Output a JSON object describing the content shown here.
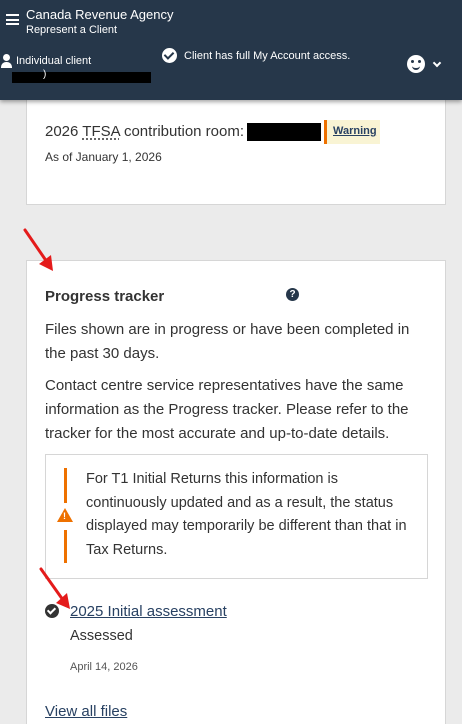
{
  "header": {
    "agency": "Canada Revenue Agency",
    "subtitle": "Represent a Client",
    "client_label": "Individual client",
    "client_name_visible": ")",
    "access_text": "Client has full My Account access."
  },
  "tfsa_card": {
    "year": "2026",
    "abbr": "TFSA",
    "label_suffix": "contribution room:",
    "warning": "Warning",
    "as_of": "As of January 1, 2026"
  },
  "progress_tracker": {
    "title": "Progress tracker",
    "help_glyph": "?",
    "para1": "Files shown are in progress or have been completed in the past 30 days.",
    "para2": "Contact centre service representatives have the same information as the Progress tracker. Please refer to the tracker for the most accurate and up-to-date details.",
    "alert_icon_glyph": "!",
    "alert_text": "For T1 Initial Returns this information is continuously updated and as a result, the status displayed may temporarily be different than that in Tax Returns.",
    "item": {
      "link": "2025 Initial assessment",
      "status": "Assessed",
      "date": "April 14, 2026"
    },
    "view_all": "View all files"
  },
  "colors": {
    "header_bg": "#26374a",
    "link": "#284162",
    "warning_accent": "#ee7100",
    "annotation_arrow": "#e41b1b"
  },
  "icons": [
    "menu-icon",
    "person-icon",
    "check-circle-icon",
    "account-face-icon",
    "chevron-down-icon",
    "help-icon",
    "warning-icon",
    "check-icon"
  ]
}
